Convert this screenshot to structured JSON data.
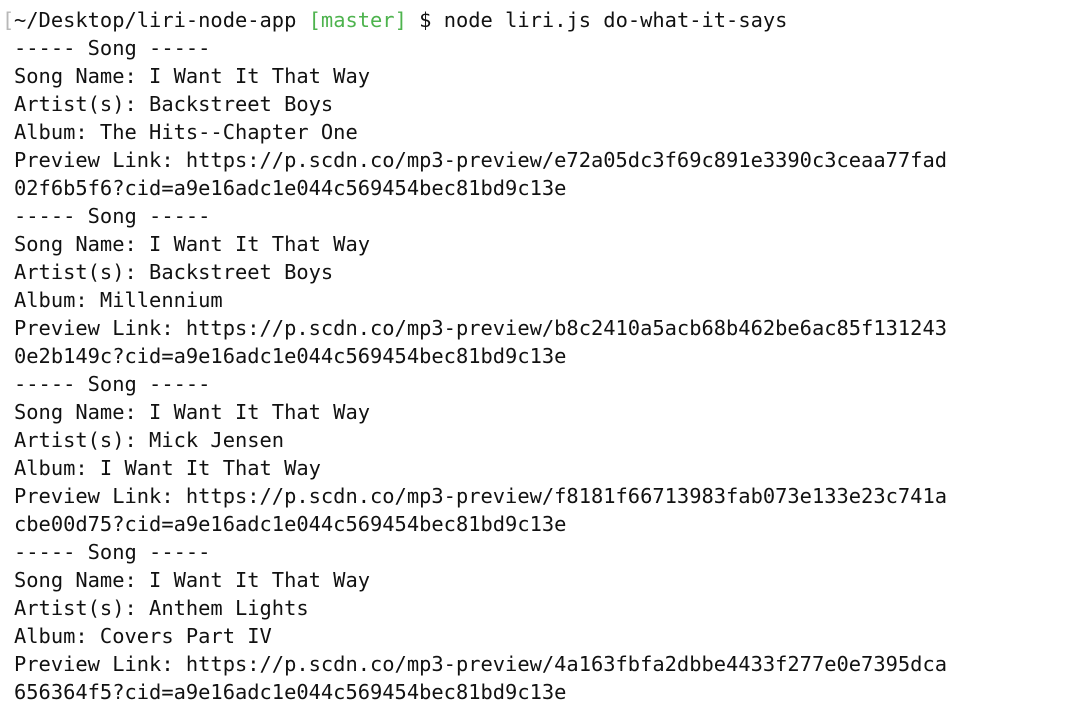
{
  "prompt": {
    "bracket": "[",
    "path": "~/Desktop/liri-node-app",
    "branch": "[master]",
    "symbol": "$",
    "command": "node liri.js do-what-it-says"
  },
  "colors": {
    "branch": "#4eb34e",
    "text": "#111111",
    "background": "#ffffff"
  },
  "songs": [
    {
      "header": "----- Song -----",
      "name_line": "Song Name: I Want It That Way",
      "artist_line": "Artist(s): Backstreet Boys",
      "album_line": "Album: The Hits--Chapter One",
      "preview_line_1": "Preview Link: https://p.scdn.co/mp3-preview/e72a05dc3f69c891e3390c3ceaa77fad",
      "preview_line_2": "02f6b5f6?cid=a9e16adc1e044c569454bec81bd9c13e"
    },
    {
      "header": "----- Song -----",
      "name_line": "Song Name: I Want It That Way",
      "artist_line": "Artist(s): Backstreet Boys",
      "album_line": "Album: Millennium",
      "preview_line_1": "Preview Link: https://p.scdn.co/mp3-preview/b8c2410a5acb68b462be6ac85f131243",
      "preview_line_2": "0e2b149c?cid=a9e16adc1e044c569454bec81bd9c13e"
    },
    {
      "header": "----- Song -----",
      "name_line": "Song Name: I Want It That Way",
      "artist_line": "Artist(s): Mick Jensen",
      "album_line": "Album: I Want It That Way",
      "preview_line_1": "Preview Link: https://p.scdn.co/mp3-preview/f8181f66713983fab073e133e23c741a",
      "preview_line_2": "cbe00d75?cid=a9e16adc1e044c569454bec81bd9c13e"
    },
    {
      "header": "----- Song -----",
      "name_line": "Song Name: I Want It That Way",
      "artist_line": "Artist(s): Anthem Lights",
      "album_line": "Album: Covers Part IV",
      "preview_line_1": "Preview Link: https://p.scdn.co/mp3-preview/4a163fbfa2dbbe4433f277e0e7395dca",
      "preview_line_2": "656364f5?cid=a9e16adc1e044c569454bec81bd9c13e"
    }
  ]
}
